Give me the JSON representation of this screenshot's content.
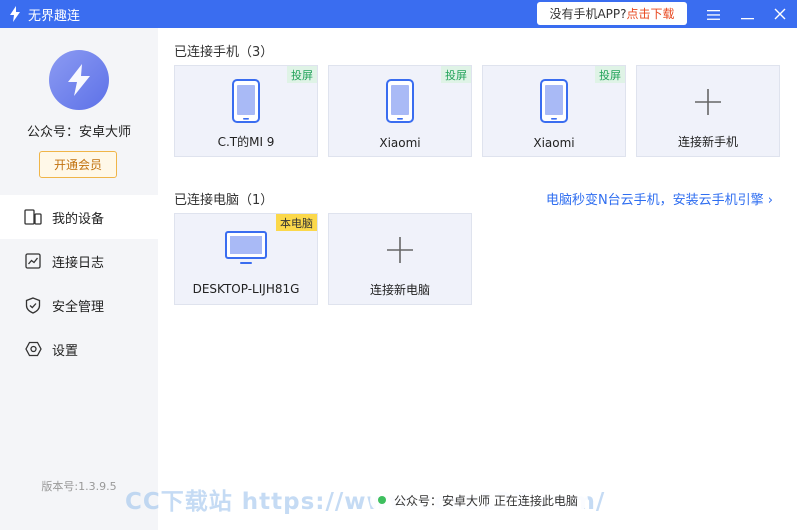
{
  "titlebar": {
    "title": "无界趣连",
    "promo_question": "没有手机APP? ",
    "promo_download": "点击下载",
    "menu_icon": "menu-icon",
    "minimize_icon": "minimize-icon",
    "close_icon": "close-icon"
  },
  "sidebar": {
    "account_name": "公众号：安卓大师",
    "vip_label": "开通会员",
    "items": [
      {
        "label": "我的设备",
        "icon": "devices-icon"
      },
      {
        "label": "连接日志",
        "icon": "chart-log-icon"
      },
      {
        "label": "安全管理",
        "icon": "shield-icon"
      },
      {
        "label": "设置",
        "icon": "gear-icon"
      }
    ],
    "version": "版本号:1.3.9.5"
  },
  "phones": {
    "section_title": "已连接手机（3）",
    "cast_tag": "投屏",
    "items": [
      {
        "name": "C.T的MI 9"
      },
      {
        "name": "Xiaomi"
      },
      {
        "name": "Xiaomi"
      }
    ],
    "add_label": "连接新手机"
  },
  "computers": {
    "section_title": "已连接电脑（1）",
    "cloud_link": "电脑秒变N台云手机，安装云手机引擎 ›",
    "this_pc_tag": "本电脑",
    "items": [
      {
        "name": "DESKTOP-LIJH81G"
      }
    ],
    "add_label": "连接新电脑"
  },
  "status": {
    "text": "公众号：安卓大师 正在连接此电脑"
  },
  "watermark": "CC下载站  https://www.ccxz123.com/",
  "colors": {
    "accent": "#3a6df0",
    "vip": "#f0b548",
    "online": "#3ebf5e",
    "cast_tag": "#22a35a",
    "this_pc_tag": "#fbd84a"
  }
}
